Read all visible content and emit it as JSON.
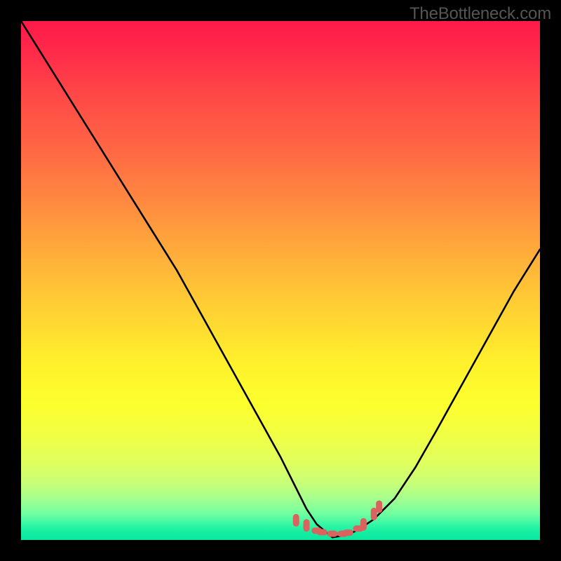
{
  "watermark": "TheBottleneck.com",
  "colors": {
    "background": "#000000",
    "curve_color": "#000000",
    "marker_color": "#d9635e",
    "watermark_color": "#555555"
  },
  "chart_data": {
    "type": "line",
    "title": "",
    "xlabel": "",
    "ylabel": "",
    "xlim": [
      0,
      100
    ],
    "ylim": [
      0,
      100
    ],
    "grid": false,
    "legend": false,
    "annotations": [],
    "note": "V-shaped bottleneck-style curve over rainbow gradient. y decreases to ~0 near x≈60 then rises. Overlaid markers near the trough.",
    "series": [
      {
        "name": "curve",
        "x": [
          0,
          5,
          10,
          15,
          20,
          25,
          30,
          35,
          40,
          45,
          50,
          53,
          55,
          57,
          60,
          63,
          65,
          68,
          72,
          76,
          80,
          85,
          90,
          95,
          100
        ],
        "values": [
          100,
          92,
          84,
          76,
          68,
          60,
          52,
          43,
          34,
          25,
          16,
          10,
          6,
          3,
          0.5,
          1,
          2,
          4,
          8,
          14,
          21,
          30,
          39,
          48,
          56
        ]
      },
      {
        "name": "trough-markers",
        "x": [
          53,
          55,
          57,
          58,
          60,
          62,
          63,
          65,
          66,
          68,
          69
        ],
        "values": [
          3.8,
          2.8,
          1.8,
          1.5,
          1.2,
          1.2,
          1.4,
          2.2,
          3.0,
          5.0,
          6.4
        ]
      }
    ]
  }
}
